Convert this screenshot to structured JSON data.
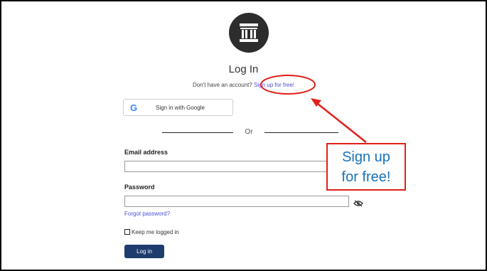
{
  "header": {
    "logo_icon": "museum-building-icon",
    "title": "Log In",
    "signup_prompt": "Don't have an account?",
    "signup_link": "Sign up for free!"
  },
  "google": {
    "icon": "google-g-icon",
    "label": "Sign in with Google"
  },
  "divider": {
    "label": "Or"
  },
  "form": {
    "email_label": "Email address",
    "email_value": "",
    "password_label": "Password",
    "password_value": "",
    "show_password_icon": "eye-slash-icon",
    "forgot_link": "Forgot password?",
    "keep_logged_in_label": "Keep me logged in",
    "keep_logged_in_checked": false,
    "submit_label": "Log in"
  },
  "annotation": {
    "callout_line1": "Sign up",
    "callout_line2": "for free!",
    "color": "#e0201b"
  },
  "colors": {
    "link": "#4a4ed6",
    "button": "#1f3c6e",
    "callout_text": "#1a72b8"
  }
}
